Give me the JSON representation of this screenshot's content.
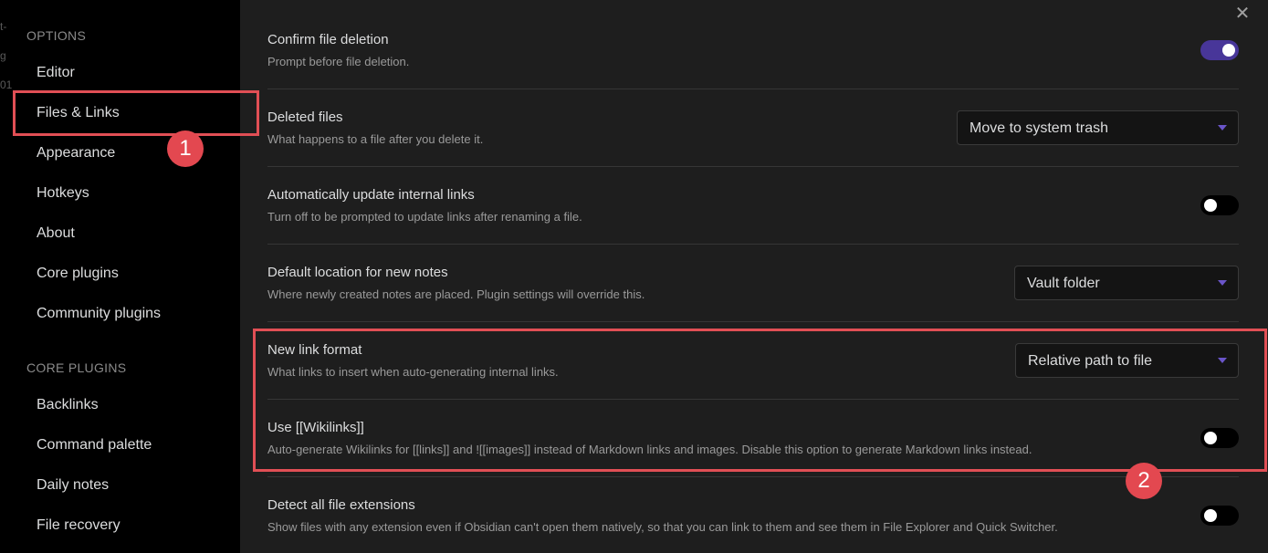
{
  "sidebar": {
    "bg_fragments": [
      "t-",
      "g",
      "01"
    ],
    "options_label": "OPTIONS",
    "options_items": [
      "Editor",
      "Files & Links",
      "Appearance",
      "Hotkeys",
      "About",
      "Core plugins",
      "Community plugins"
    ],
    "core_plugins_label": "CORE PLUGINS",
    "core_plugin_items": [
      "Backlinks",
      "Command palette",
      "Daily notes",
      "File recovery"
    ]
  },
  "annotations": {
    "badge1": "1",
    "badge2": "2",
    "accent": "#e14f55"
  },
  "close_icon": "✕",
  "settings": [
    {
      "name": "Confirm file deletion",
      "desc": "Prompt before file deletion.",
      "control": "toggle",
      "on": true
    },
    {
      "name": "Deleted files",
      "desc": "What happens to a file after you delete it.",
      "control": "dropdown",
      "value": "Move to system trash"
    },
    {
      "name": "Automatically update internal links",
      "desc": "Turn off to be prompted to update links after renaming a file.",
      "control": "toggle",
      "on": false
    },
    {
      "name": "Default location for new notes",
      "desc": "Where newly created notes are placed. Plugin settings will override this.",
      "control": "dropdown",
      "value": "Vault folder"
    },
    {
      "name": "New link format",
      "desc": "What links to insert when auto-generating internal links.",
      "control": "dropdown",
      "value": "Relative path to file"
    },
    {
      "name": "Use [[Wikilinks]]",
      "desc": "Auto-generate Wikilinks for [[links]] and ![[images]] instead of Markdown links and images. Disable this option to generate Markdown links instead.",
      "control": "toggle",
      "on": false
    },
    {
      "name": "Detect all file extensions",
      "desc": "Show files with any extension even if Obsidian can't open them natively, so that you can link to them and see them in File Explorer and Quick Switcher.",
      "control": "toggle",
      "on": false
    }
  ],
  "colors": {
    "toggle_on": "#483699",
    "dropdown_caret": "#6a55c9"
  }
}
